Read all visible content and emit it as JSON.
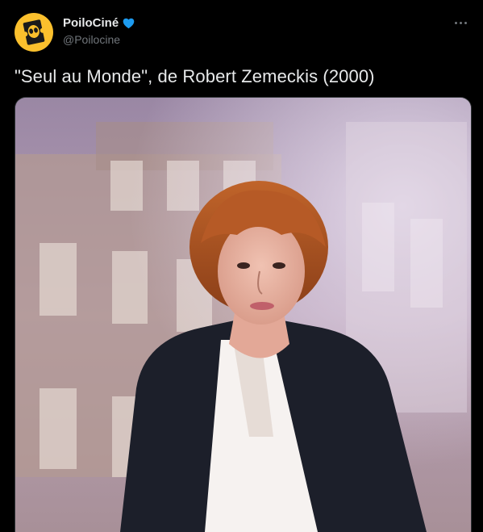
{
  "tweet": {
    "author": {
      "display_name": "PoiloCiné",
      "handle": "@Poilocine",
      "verified_icon": "verified-badge-icon",
      "avatar_icon": "alien-ticket-logo"
    },
    "more_icon": "more-options-icon",
    "text": "\"Seul au Monde\", de Robert Zemeckis (2000)",
    "media": {
      "kind": "photo",
      "subject": "news-anchor-photo"
    }
  },
  "colors": {
    "background": "#000000",
    "text_primary": "#e7e9ea",
    "text_secondary": "#71767b",
    "verified_blue": "#1d9bf0",
    "avatar_yellow": "#fbc02d"
  }
}
